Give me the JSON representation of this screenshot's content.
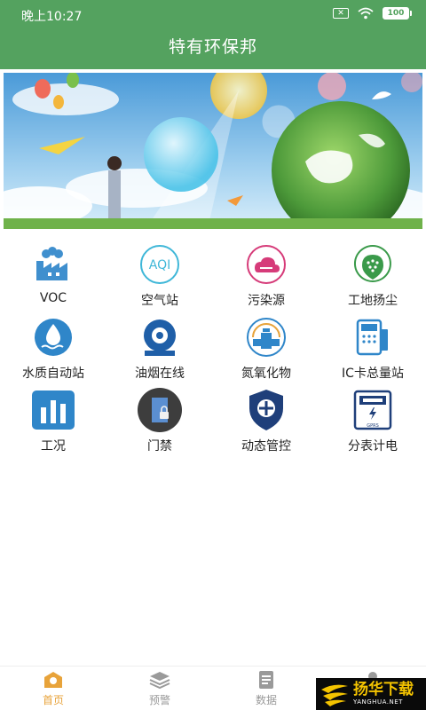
{
  "status": {
    "time": "晚上10:27",
    "battery": "100"
  },
  "header": {
    "title": "特有环保邦"
  },
  "grid": {
    "items": [
      {
        "label": "VOC",
        "icon": "factory-icon"
      },
      {
        "label": "空气站",
        "icon": "aqi-icon"
      },
      {
        "label": "污染源",
        "icon": "cloud-pollution-icon"
      },
      {
        "label": "工地扬尘",
        "icon": "dust-icon"
      },
      {
        "label": "水质自动站",
        "icon": "water-drop-icon"
      },
      {
        "label": "油烟在线",
        "icon": "range-hood-icon"
      },
      {
        "label": "氮氧化物",
        "icon": "pipe-valve-icon"
      },
      {
        "label": "IC卡总量站",
        "icon": "card-reader-icon"
      },
      {
        "label": "工况",
        "icon": "bar-chart-icon"
      },
      {
        "label": "门禁",
        "icon": "door-lock-icon"
      },
      {
        "label": "动态管控",
        "icon": "shield-icon"
      },
      {
        "label": "分表计电",
        "icon": "electric-meter-icon"
      }
    ],
    "aqi_text": "AQI",
    "meter_text": "GPRS"
  },
  "tabs": [
    {
      "label": "首页",
      "active": true
    },
    {
      "label": "预警",
      "active": false
    },
    {
      "label": "数据",
      "active": false
    },
    {
      "label": "",
      "active": false
    }
  ],
  "watermark": {
    "title": "扬华下载",
    "sub": "YANGHUA.NET"
  },
  "colors": {
    "header": "#54a25f",
    "tab_active": "#e8a33a"
  }
}
